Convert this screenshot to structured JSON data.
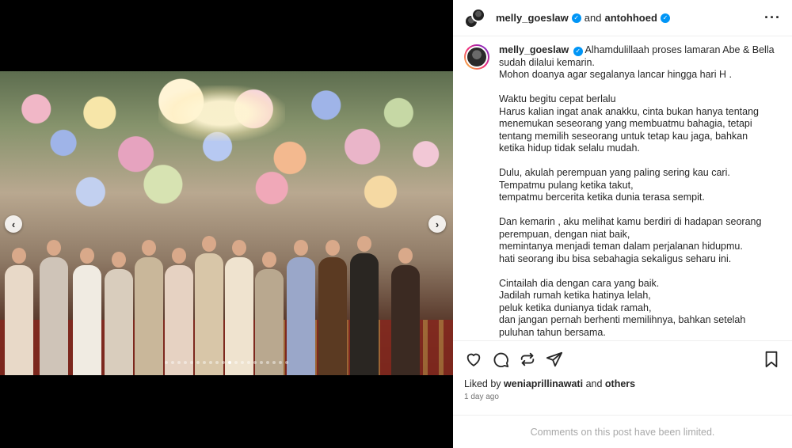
{
  "header": {
    "user1": "melly_goeslaw",
    "joiner": "and",
    "user2": "antohhoed",
    "more_icon": "ellipsis-icon"
  },
  "media": {
    "description_icons": {
      "prev": "chevron-left-icon",
      "next": "chevron-right-icon"
    },
    "prev_glyph": "‹",
    "next_glyph": "›",
    "carousel": {
      "total": 20,
      "active_index": 10
    }
  },
  "caption": {
    "username": "melly_goeslaw",
    "first_line_text": "Alhamdulillaah proses lamaran Abe & Bella",
    "lines": [
      "sudah dilalui kemarin.",
      "Mohon doanya agar segalanya lancar hingga hari H .",
      "",
      "Waktu begitu cepat berlalu",
      "Harus kalian ingat anak anakku, cinta bukan hanya tentang",
      "menemukan seseorang yang membuatmu bahagia, tetapi",
      "tentang memilih seseorang untuk tetap kau jaga, bahkan",
      "ketika hidup tidak selalu mudah.",
      "",
      "Dulu, akulah perempuan yang paling sering kau cari.",
      "Tempatmu pulang ketika takut,",
      "tempatmu bercerita ketika dunia terasa sempit.",
      "",
      "Dan kemarin , aku melihat kamu berdiri di hadapan seorang",
      "perempuan, dengan niat baik,",
      "memintanya menjadi teman dalam perjalanan hidupmu.",
      "hati seorang ibu bisa sebahagia sekaligus seharu ini.",
      "",
      "Cintailah dia dengan cara yang baik.",
      "Jadilah rumah ketika hatinya lelah,",
      "peluk ketika dunianya tidak ramah,",
      "dan jangan pernah berhenti memilihnya, bahkan setelah",
      "puluhan tahun bersama."
    ]
  },
  "actions": {
    "like_icon": "heart-icon",
    "comment_icon": "comment-icon",
    "repost_icon": "repost-icon",
    "share_icon": "send-icon",
    "save_icon": "bookmark-icon"
  },
  "likes": {
    "prefix": "Liked by",
    "user": "weniaprillinawati",
    "joiner": "and",
    "others": "others"
  },
  "timestamp": "1 day ago",
  "footer_text": "Comments on this post have been limited.",
  "colors": {
    "verified": "#0095f6",
    "text": "#262626",
    "muted": "#737373",
    "footer": "#a8a8a8"
  }
}
